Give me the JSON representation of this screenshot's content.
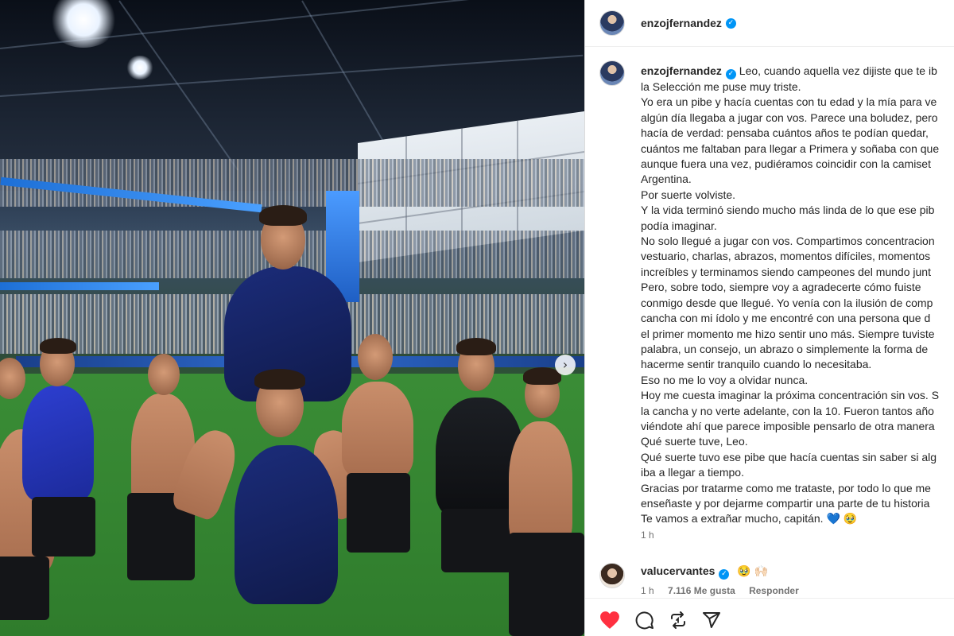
{
  "post": {
    "author": "enzojfernandez",
    "verified": true,
    "caption_lines": [
      "Leo, cuando aquella vez dijiste que te ib",
      "la Selección me puse muy triste.",
      "Yo era un pibe y hacía cuentas con tu edad y la mía para ve",
      "algún día llegaba a jugar con vos. Parece una boludez, pero",
      "hacía de verdad: pensaba cuántos años te podían quedar,",
      "cuántos me faltaban para llegar a Primera y soñaba con que",
      "aunque fuera una vez, pudiéramos coincidir con la camiset",
      "Argentina.",
      "Por suerte volviste.",
      "Y la vida terminó siendo mucho más linda de lo que ese pib",
      "podía imaginar.",
      "No solo llegué a jugar con vos. Compartimos concentracion",
      "vestuario, charlas, abrazos, momentos difíciles, momentos",
      "increíbles y terminamos siendo campeones del mundo junt",
      "Pero, sobre todo, siempre voy a agradecerte cómo fuiste",
      "conmigo desde que llegué. Yo venía con la ilusión de comp",
      "cancha con mi ídolo y me encontré con una persona que d",
      "el primer momento me hizo sentir uno más. Siempre tuviste",
      "palabra, un consejo, un abrazo o simplemente la forma de",
      "hacerme sentir tranquilo cuando lo necesitaba.",
      "Eso no me lo voy a olvidar nunca.",
      "Hoy me cuesta imaginar la próxima concentración sin vos. S",
      "la cancha y no verte adelante, con la 10. Fueron tantos año",
      "viéndote ahí que parece imposible pensarlo de otra manera",
      "Qué suerte tuve, Leo.",
      "Qué suerte tuvo ese pibe que hacía cuentas sin saber si alg",
      "iba a llegar a tiempo.",
      "Gracias por tratarme como me trataste, por todo lo que me",
      "enseñaste y por dejarme compartir una parte de tu historia",
      "Te vamos a extrañar mucho, capitán. 💙 🥹"
    ],
    "time_ago": "1 h"
  },
  "comment": {
    "author": "valucervantes",
    "verified": true,
    "text": "🥹 🙌🏻",
    "time_ago": "1 h",
    "likes": "7.116 Me gusta",
    "reply_label": "Responder"
  },
  "actions": {
    "like_icon": "heart-icon",
    "comment_icon": "comment-icon",
    "share_icon": "repost-icon",
    "send_icon": "send-icon",
    "liked": true,
    "like_color": "#ff3040"
  },
  "colors": {
    "verified": "#0095f6",
    "text": "#262626",
    "muted": "#737373"
  }
}
